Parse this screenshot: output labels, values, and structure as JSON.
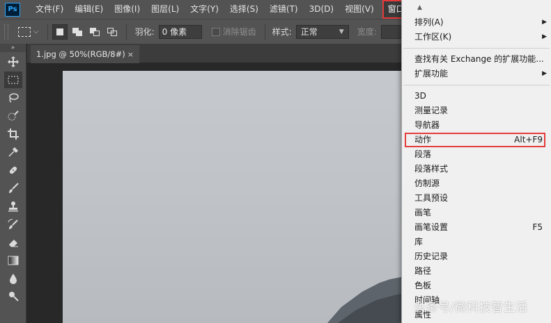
{
  "app": {
    "logo": "Ps"
  },
  "menubar": {
    "items": [
      "文件(F)",
      "编辑(E)",
      "图像(I)",
      "图层(L)",
      "文字(Y)",
      "选择(S)",
      "滤镜(T)",
      "3D(D)",
      "视图(V)"
    ],
    "active": "窗口(W)"
  },
  "options": {
    "feather_label": "羽化:",
    "feather_value": "0 像素",
    "antialias_label": "消除锯齿",
    "style_label": "样式:",
    "style_value": "正常",
    "width_label": "宽度:"
  },
  "document": {
    "tab_title": "1.jpg @ 50%(RGB/8#)",
    "tab_close": "×"
  },
  "tools": [
    "move-icon",
    "rect-marquee-icon",
    "lasso-icon",
    "quick-select-icon",
    "crop-icon",
    "eyedropper-icon",
    "healing-brush-icon",
    "brush-icon",
    "clone-stamp-icon",
    "history-brush-icon",
    "eraser-icon",
    "gradient-icon",
    "blur-icon",
    "dodge-icon"
  ],
  "window_menu": {
    "group1": [
      {
        "label": "排列(A)",
        "submenu": true
      },
      {
        "label": "工作区(K)",
        "submenu": true
      }
    ],
    "group2": [
      {
        "label": "查找有关 Exchange 的扩展功能..."
      },
      {
        "label": "扩展功能",
        "submenu": true
      }
    ],
    "group3": [
      {
        "label": "3D",
        "shortcut": ""
      },
      {
        "label": "测量记录",
        "shortcut": ""
      },
      {
        "label": "导航器",
        "shortcut": ""
      },
      {
        "label": "动作",
        "shortcut": "Alt+F9"
      },
      {
        "label": "段落",
        "shortcut": ""
      },
      {
        "label": "段落样式",
        "shortcut": ""
      },
      {
        "label": "仿制源",
        "shortcut": ""
      },
      {
        "label": "工具预设",
        "shortcut": ""
      },
      {
        "label": "画笔",
        "shortcut": ""
      },
      {
        "label": "画笔设置",
        "shortcut": "F5"
      },
      {
        "label": "库",
        "shortcut": ""
      },
      {
        "label": "历史记录",
        "shortcut": ""
      },
      {
        "label": "路径",
        "shortcut": ""
      },
      {
        "label": "色板",
        "shortcut": ""
      },
      {
        "label": "时间轴",
        "shortcut": ""
      },
      {
        "label": "属性",
        "shortcut": ""
      }
    ]
  },
  "watermark": "头条号/微科技智生活",
  "colors": {
    "highlight": "#e63a3a",
    "menubar": "#535353",
    "menu_bg": "#f0f0f0"
  }
}
